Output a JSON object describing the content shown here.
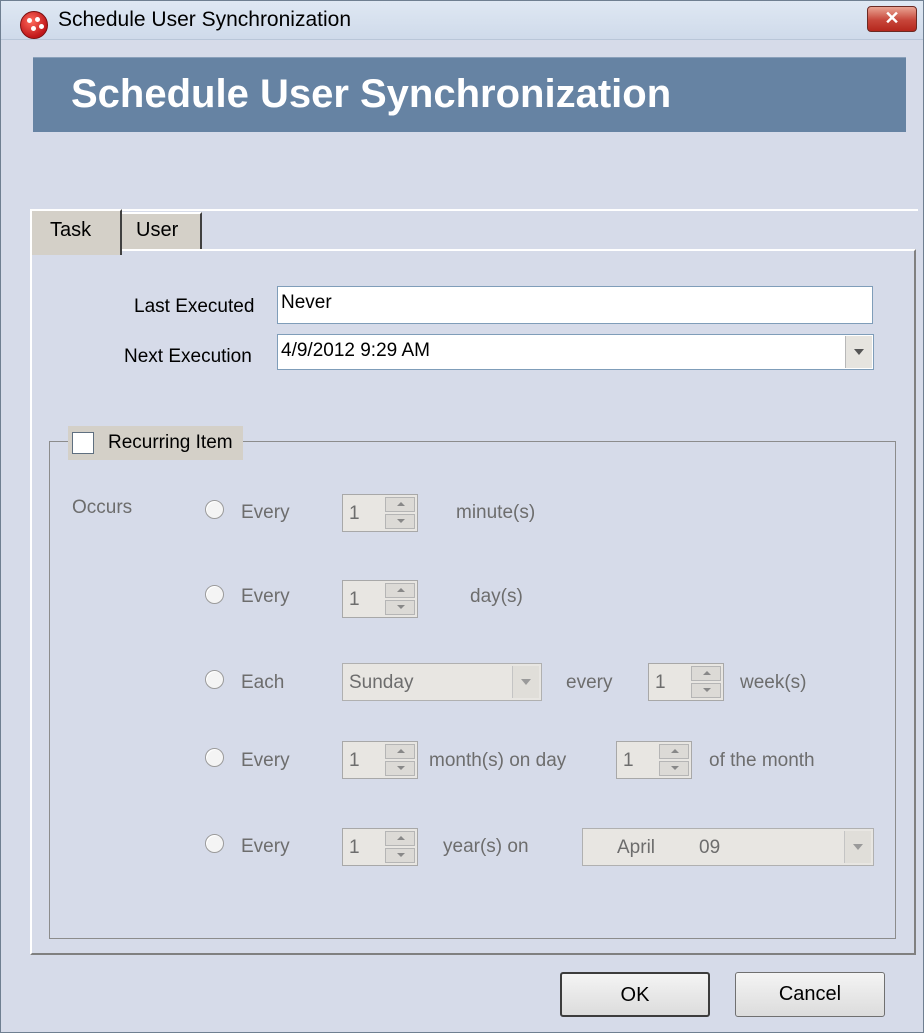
{
  "window": {
    "title": "Schedule User Synchronization"
  },
  "banner": {
    "title": "Schedule User Synchronization"
  },
  "tabs": [
    {
      "label": "Task"
    },
    {
      "label": "User"
    }
  ],
  "task": {
    "last_executed_label": "Last Executed",
    "last_executed_value": "Never",
    "next_execution_label": "Next Execution",
    "next_execution_value": "4/9/2012 9:29 AM"
  },
  "recurring": {
    "label": "Recurring Item",
    "checked": false,
    "occurs_label": "Occurs",
    "rows": [
      {
        "prefix": "Every",
        "value": "1",
        "unit": "minute(s)"
      },
      {
        "prefix": "Every",
        "value": "1",
        "unit": "day(s)"
      },
      {
        "prefix": "Each",
        "day": "Sunday",
        "middle": "every",
        "value": "1",
        "unit": "week(s)"
      },
      {
        "prefix": "Every",
        "value": "1",
        "middle": "month(s) on day",
        "value2": "1",
        "unit": "of the month"
      },
      {
        "prefix": "Every",
        "value": "1",
        "middle": "year(s) on",
        "month": "April",
        "day": "09"
      }
    ]
  },
  "buttons": {
    "ok": "OK",
    "cancel": "Cancel"
  }
}
